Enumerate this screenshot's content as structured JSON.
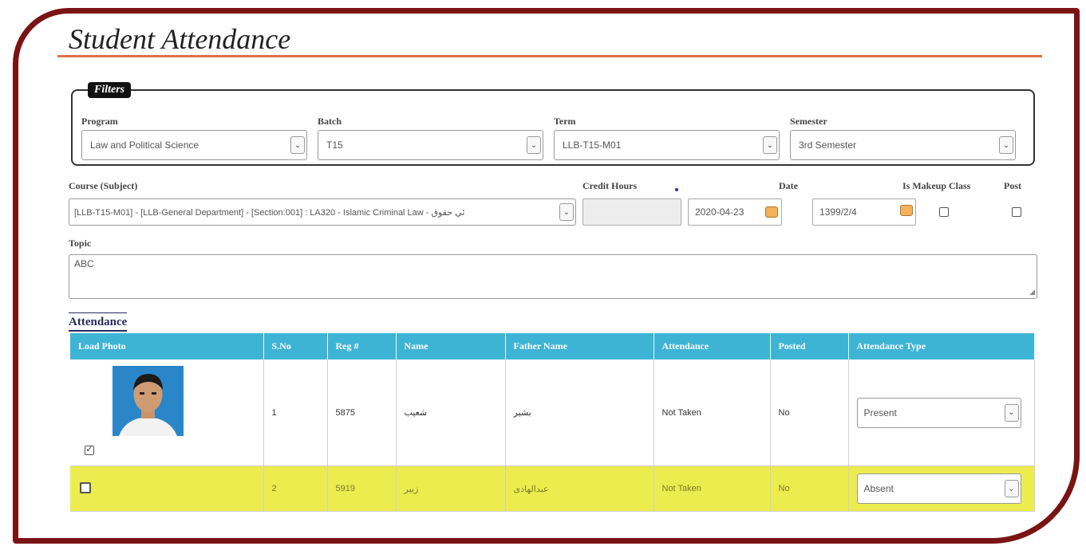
{
  "page": {
    "title": "Student Attendance"
  },
  "filters": {
    "legend": "Filters",
    "program": {
      "label": "Program",
      "value": "Law and Political Science"
    },
    "batch": {
      "label": "Batch",
      "value": "T15"
    },
    "term": {
      "label": "Term",
      "value": "LLB-T15-M01"
    },
    "semester": {
      "label": "Semester",
      "value": "3rd Semester"
    }
  },
  "form": {
    "course": {
      "label": "Course (Subject)",
      "value": "[LLB-T15-M01] - [LLB-General Department] - [Section:001] : LA320 - Islamic Criminal Law - ئي حقوق"
    },
    "credit_hours": {
      "label": "Credit Hours",
      "value": ""
    },
    "date": {
      "label": "Date",
      "gregorian": "2020-04-23",
      "hijri": "1399/2/4"
    },
    "makeup": {
      "label": "Is Makeup Class"
    },
    "post": {
      "label": "Post"
    },
    "topic": {
      "label": "Topic",
      "value": "ABC"
    }
  },
  "attendance": {
    "title": "Attendance",
    "columns": [
      "Load Photo",
      "S.No",
      "Reg #",
      "Name",
      "Father Name",
      "Attendance",
      "Posted",
      "Attendance Type"
    ],
    "rows": [
      {
        "sno": "1",
        "reg": "5875",
        "name": "شعیب",
        "father": "بشیر",
        "attendance": "Not Taken",
        "posted": "No",
        "type": "Present",
        "checked": true
      },
      {
        "sno": "2",
        "reg": "5919",
        "name": "زبیر",
        "father": "عبدالهادی",
        "attendance": "Not Taken",
        "posted": "No",
        "type": "Absent",
        "checked": false
      }
    ]
  },
  "colors": {
    "frame": "#7a1414",
    "header": "#3eb4d4",
    "highlight": "#ecec4e",
    "accent_rule": "#e07040"
  }
}
